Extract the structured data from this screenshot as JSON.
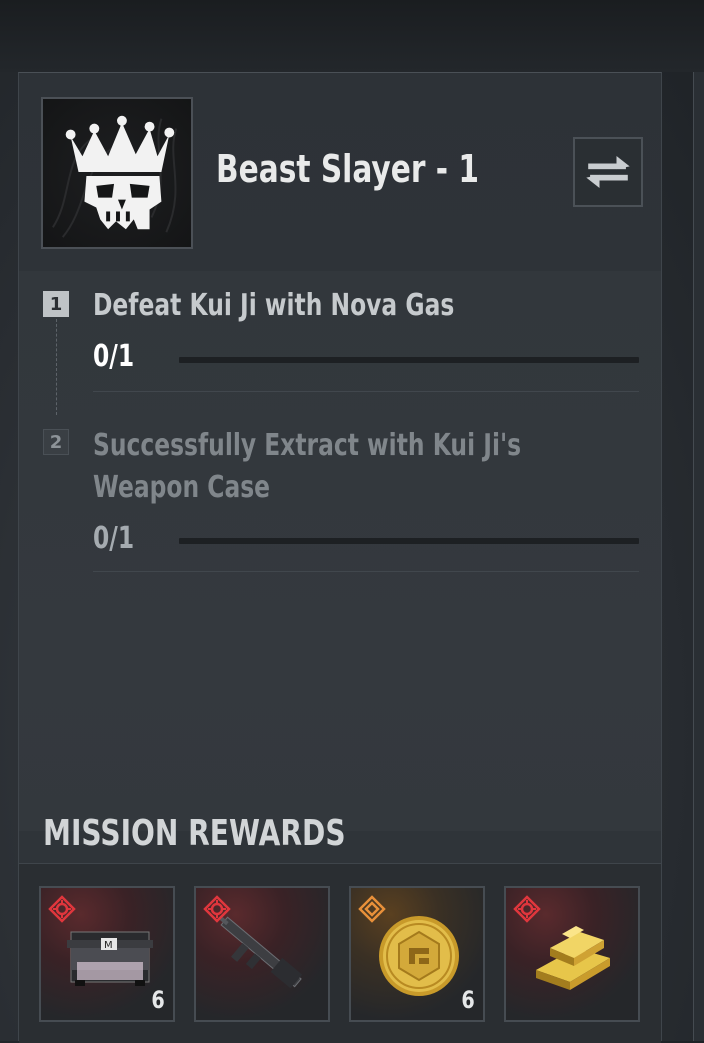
{
  "mission": {
    "title": "Beast Slayer - 1"
  },
  "objectives": [
    {
      "number": "1",
      "text_lines": [
        "Defeat Kui Ji with Nova Gas"
      ],
      "progress": "0/1",
      "fraction": 0,
      "state": "active"
    },
    {
      "number": "2",
      "text_lines": [
        "Successfully Extract with Kui Ji's",
        "Weapon Case"
      ],
      "progress": "0/1",
      "fraction": 0,
      "state": "inactive"
    }
  ],
  "rewards": {
    "title": "MISSION REWARDS",
    "items": [
      {
        "icon": "weapon-case-icon",
        "rarity": "red",
        "quantity": "6"
      },
      {
        "icon": "rifle-icon",
        "rarity": "red",
        "quantity": ""
      },
      {
        "icon": "gold-coin-icon",
        "rarity": "orange",
        "quantity": "6"
      },
      {
        "icon": "gold-bars-icon",
        "rarity": "red",
        "quantity": ""
      }
    ]
  },
  "colors": {
    "rarity_red": "#e0363d",
    "rarity_orange": "#e8903a",
    "gold": "#d9b43a"
  }
}
